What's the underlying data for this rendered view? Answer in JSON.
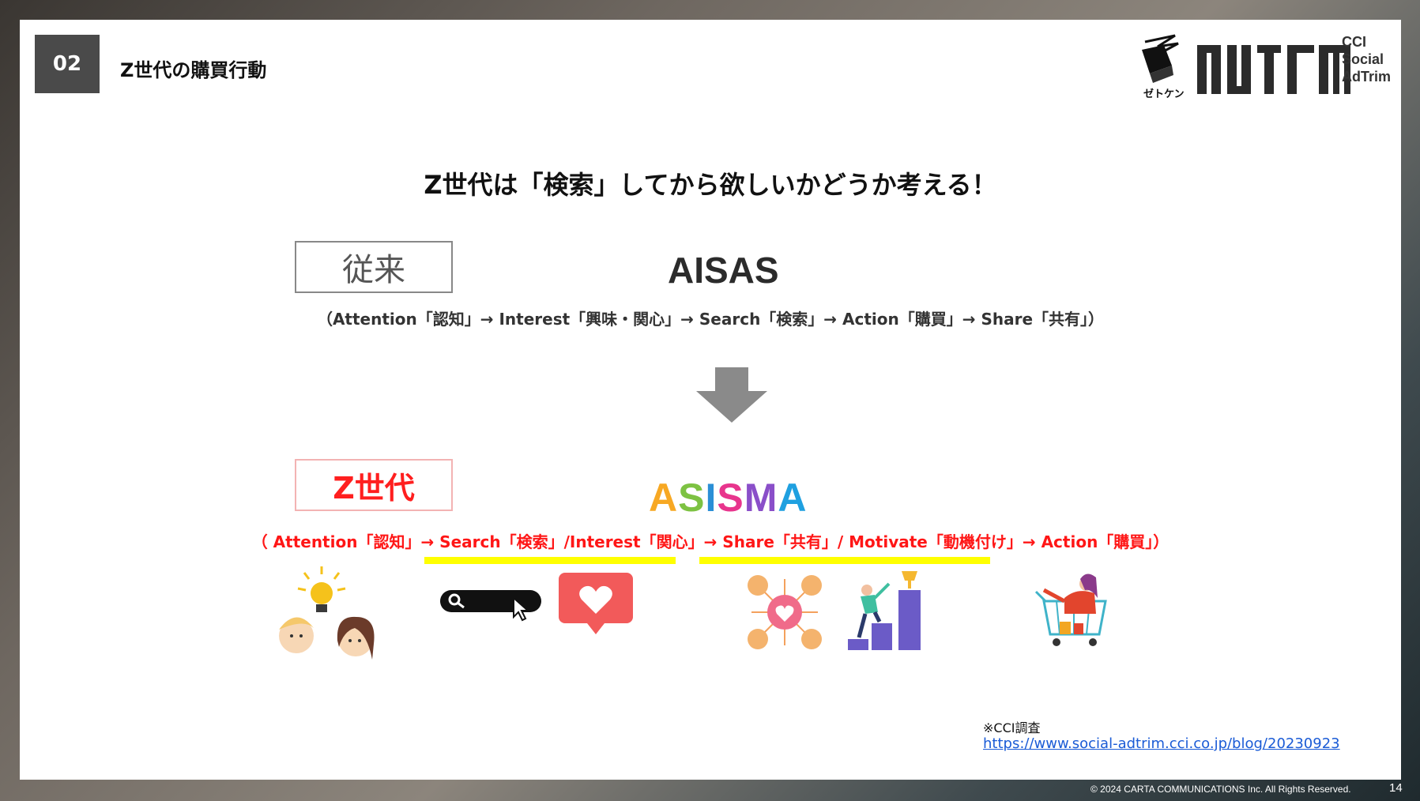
{
  "header": {
    "section_number": "02",
    "section_title": "Z世代の購買行動",
    "logo_caption": "ゼトケン",
    "brand_lines": [
      "CCI",
      "Social",
      "AdTrim"
    ]
  },
  "headline": "Z世代は「検索」してから欲しいかどうか考える！",
  "old_model": {
    "box_label": "従来",
    "name": "AISAS",
    "flow": "（Attention「認知」→ Interest「興味・関心」→ Search「検索」→ Action「購買」→ Share「共有」）"
  },
  "new_model": {
    "box_label": "Z世代",
    "name_letters": [
      {
        "ch": "A",
        "color": "#f7a823"
      },
      {
        "ch": "S",
        "color": "#7dc242"
      },
      {
        "ch": "I",
        "color": "#2b8fd6"
      },
      {
        "ch": "S",
        "color": "#e8358d"
      },
      {
        "ch": "M",
        "color": "#8a4fc9"
      },
      {
        "ch": "A",
        "color": "#1fa0e0"
      }
    ],
    "flow": "（ Attention「認知」→ Search「検索」/Interest「関心」→ Share「共有」/ Motivate「動機付け」→ Action「購買」）",
    "highlight_color": "#ffff00"
  },
  "icons": [
    "idea-people-icon",
    "search-bar-icon",
    "heart-like-icon",
    "network-heart-icon",
    "growth-chart-icon",
    "shopping-cart-icon"
  ],
  "note": {
    "source": "※CCI調査",
    "url": "https://www.social-adtrim.cci.co.jp/blog/20230923"
  },
  "footer": {
    "copyright": "© 2024 CARTA COMMUNICATIONS Inc.  All Rights Reserved.",
    "page": "14"
  }
}
